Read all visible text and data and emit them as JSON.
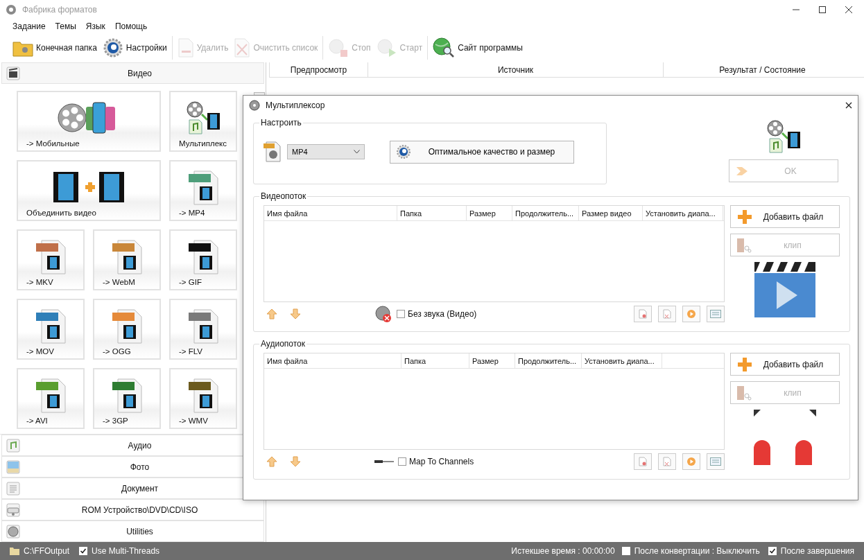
{
  "window": {
    "title": "Фабрика форматов"
  },
  "menu": [
    "Задание",
    "Темы",
    "Язык",
    "Помощь"
  ],
  "toolbar": [
    {
      "kind": "folder",
      "label": "Конечная папка",
      "disabled": false
    },
    {
      "kind": "gear",
      "label": "Настройки",
      "disabled": false
    },
    {
      "kind": "remove",
      "label": "Удалить",
      "disabled": true
    },
    {
      "kind": "clear",
      "label": "Очистить список",
      "disabled": true
    },
    {
      "kind": "stop",
      "label": "Стоп",
      "disabled": true
    },
    {
      "kind": "start",
      "label": "Старт",
      "disabled": true
    },
    {
      "kind": "globe",
      "label": "Сайт программы",
      "disabled": false
    }
  ],
  "sidebar": {
    "sections": [
      {
        "kind": "video",
        "label": "Видео",
        "expanded": true
      },
      {
        "kind": "audio",
        "label": "Аудио",
        "expanded": false
      },
      {
        "kind": "photo",
        "label": "Фото",
        "expanded": false
      },
      {
        "kind": "document",
        "label": "Документ",
        "expanded": false
      },
      {
        "kind": "disc",
        "label": "ROM Устройство\\DVD\\CD\\ISO",
        "expanded": false
      },
      {
        "kind": "reel",
        "label": "Utilities",
        "expanded": false
      }
    ],
    "tiles": [
      {
        "kind": "wide",
        "label": "-> Мобильные"
      },
      {
        "kind": "small",
        "label": "Мультиплекс"
      },
      {
        "kind": "wide",
        "label": "Объединить видео"
      },
      {
        "kind": "small",
        "label": "-> MP4",
        "color": "#4e9e7a"
      },
      {
        "kind": "small",
        "label": "-> MKV",
        "color": "#c0704a"
      },
      {
        "kind": "small",
        "label": "-> WebM",
        "color": "#c9873a"
      },
      {
        "kind": "small",
        "label": "-> GIF",
        "color": "#111111"
      },
      {
        "kind": "small",
        "label": "-> MOV",
        "color": "#2f7fb8"
      },
      {
        "kind": "small",
        "label": "-> OGG",
        "color": "#e58a3a"
      },
      {
        "kind": "small",
        "label": "-> FLV",
        "color": "#7a7a7a"
      },
      {
        "kind": "small",
        "label": "-> AVI",
        "color": "#5a9e2f"
      },
      {
        "kind": "small",
        "label": "-> 3GP",
        "color": "#2e7d32"
      },
      {
        "kind": "small",
        "label": "-> WMV",
        "color": "#6b5a1e"
      }
    ]
  },
  "task_table": {
    "columns": [
      "Предпросмотр",
      "Источник",
      "Результат / Состояние"
    ]
  },
  "dialog": {
    "title": "Мультиплексор",
    "setup": {
      "label": "Настроить",
      "format": "MP4",
      "quality_button": "Оптимальное качество и размер"
    },
    "ok_button": {
      "label": "OK",
      "disabled": true
    },
    "streams": [
      {
        "kind": "video",
        "label": "Видеопоток",
        "columns": [
          "Имя файла",
          "Папка",
          "Размер",
          "Продолжитель...",
          "Размер видео",
          "Установить диапа..."
        ],
        "option": {
          "label": "Без звука (Видео)",
          "checked": false
        },
        "add_button": "Добавить файл",
        "clip_button": {
          "label": "клип",
          "disabled": true
        }
      },
      {
        "kind": "audio",
        "label": "Аудиопоток",
        "columns": [
          "Имя файла",
          "Папка",
          "Размер",
          "Продолжитель...",
          "Установить диапа..."
        ],
        "option": {
          "label": "Map To Channels",
          "checked": false
        },
        "add_button": "Добавить файл",
        "clip_button": {
          "label": "клип",
          "disabled": true
        }
      }
    ]
  },
  "status_bar": {
    "path": "C:\\FFOutput",
    "multithreads": {
      "label": "Use Multi-Threads",
      "checked": true
    },
    "elapsed": "Истекшее время : 00:00:00",
    "after_convert": {
      "label": "После конвертации : Выключить",
      "checked": false
    },
    "after_finish": {
      "label": "После завершения",
      "checked": true
    }
  }
}
